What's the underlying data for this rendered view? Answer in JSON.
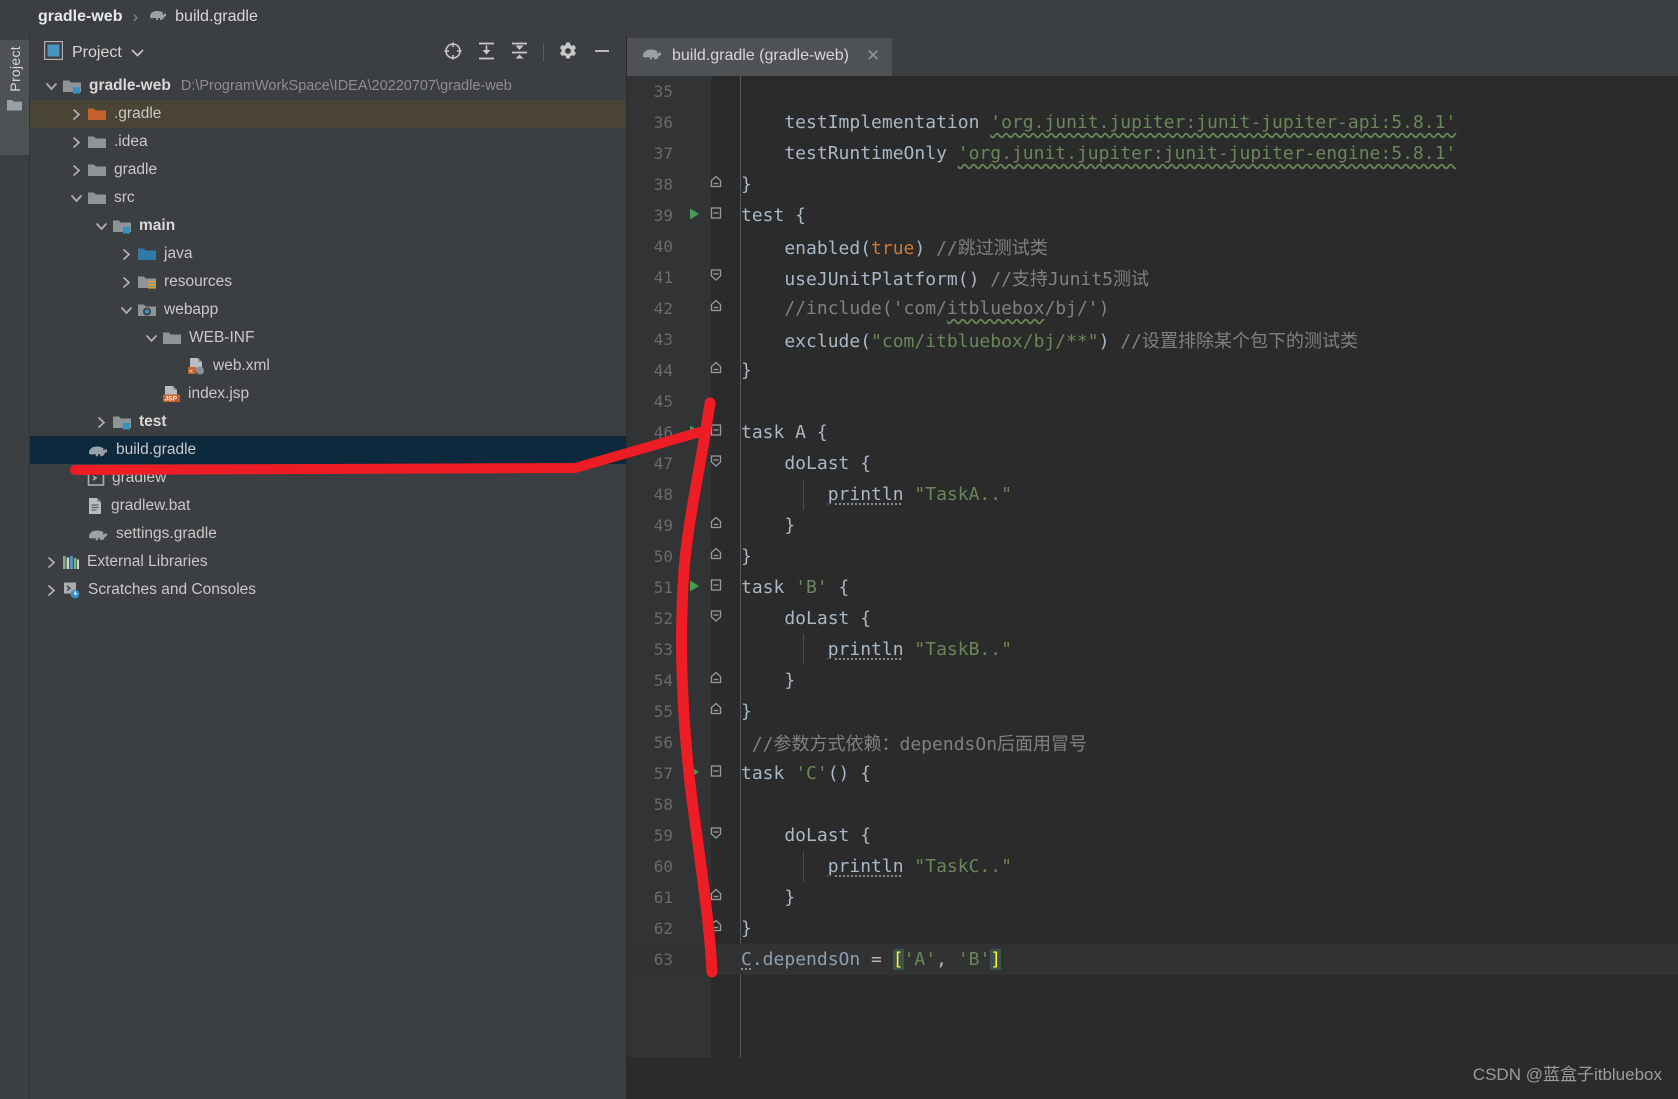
{
  "window": {
    "breadcrumb": {
      "project": "gradle-web",
      "separator": "›",
      "file": "build.gradle"
    },
    "watermark": "CSDN @蓝盒子itbluebox"
  },
  "tool_stripe": {
    "project_button_label": "Project",
    "project_button_icon": "folder-icon"
  },
  "project_panel": {
    "title": "Project",
    "title_icon": "project-view-icon",
    "dropdown_icon": "chevron-down-icon",
    "toolbar_icons": [
      "select-opened-file-icon",
      "expand-all-icon",
      "collapse-all-icon",
      "settings-gear-icon",
      "hide-panel-icon"
    ],
    "tree": [
      {
        "label": "gradle-web",
        "path": "D:\\ProgramWorkSpace\\IDEA\\20220707\\gradle-web",
        "icon": "module-folder-icon",
        "arrow": "expanded",
        "depth": 0,
        "bold": true,
        "state": "normal"
      },
      {
        "label": ".gradle",
        "path": "",
        "icon": "excluded-folder-icon",
        "arrow": "collapsed",
        "depth": 1,
        "bold": false,
        "state": "hover"
      },
      {
        "label": ".idea",
        "path": "",
        "icon": "folder-icon",
        "arrow": "collapsed",
        "depth": 1,
        "bold": false,
        "state": "normal"
      },
      {
        "label": "gradle",
        "path": "",
        "icon": "folder-icon",
        "arrow": "collapsed",
        "depth": 1,
        "bold": false,
        "state": "normal"
      },
      {
        "label": "src",
        "path": "",
        "icon": "folder-icon",
        "arrow": "expanded",
        "depth": 1,
        "bold": false,
        "state": "normal"
      },
      {
        "label": "main",
        "path": "",
        "icon": "module-folder-icon",
        "arrow": "expanded",
        "depth": 2,
        "bold": true,
        "state": "normal"
      },
      {
        "label": "java",
        "path": "",
        "icon": "source-root-icon",
        "arrow": "collapsed",
        "depth": 3,
        "bold": false,
        "state": "normal"
      },
      {
        "label": "resources",
        "path": "",
        "icon": "resource-root-icon",
        "arrow": "collapsed",
        "depth": 3,
        "bold": false,
        "state": "normal"
      },
      {
        "label": "webapp",
        "path": "",
        "icon": "web-root-icon",
        "arrow": "expanded",
        "depth": 3,
        "bold": false,
        "state": "normal"
      },
      {
        "label": "WEB-INF",
        "path": "",
        "icon": "folder-icon",
        "arrow": "expanded",
        "depth": 4,
        "bold": false,
        "state": "normal"
      },
      {
        "label": "web.xml",
        "path": "",
        "icon": "xml-file-icon",
        "arrow": "none",
        "depth": 5,
        "bold": false,
        "state": "normal"
      },
      {
        "label": "index.jsp",
        "path": "",
        "icon": "jsp-file-icon",
        "arrow": "none",
        "depth": 4,
        "bold": false,
        "state": "normal"
      },
      {
        "label": "test",
        "path": "",
        "icon": "module-folder-icon",
        "arrow": "collapsed",
        "depth": 2,
        "bold": true,
        "state": "normal"
      },
      {
        "label": "build.gradle",
        "path": "",
        "icon": "gradle-file-icon",
        "arrow": "none",
        "depth": 1,
        "bold": false,
        "state": "selected"
      },
      {
        "label": "gradlew",
        "path": "",
        "icon": "shell-script-icon",
        "arrow": "none",
        "depth": 1,
        "bold": false,
        "state": "normal"
      },
      {
        "label": "gradlew.bat",
        "path": "",
        "icon": "bat-file-icon",
        "arrow": "none",
        "depth": 1,
        "bold": false,
        "state": "normal"
      },
      {
        "label": "settings.gradle",
        "path": "",
        "icon": "gradle-file-icon",
        "arrow": "none",
        "depth": 1,
        "bold": false,
        "state": "normal"
      },
      {
        "label": "External Libraries",
        "path": "",
        "icon": "external-libraries-icon",
        "arrow": "collapsed",
        "depth": 0,
        "bold": false,
        "state": "normal"
      },
      {
        "label": "Scratches and Consoles",
        "path": "",
        "icon": "scratches-icon",
        "arrow": "collapsed",
        "depth": 0,
        "bold": false,
        "state": "normal"
      }
    ]
  },
  "editor": {
    "tabs": [
      {
        "label": "build.gradle (gradle-web)",
        "icon": "gradle-file-icon",
        "close_icon": "close-icon",
        "active": true
      }
    ],
    "first_line_number": 35,
    "lines": [
      {
        "n": 35,
        "run": false,
        "fold": "none",
        "caret": false,
        "tokens": []
      },
      {
        "n": 36,
        "run": false,
        "fold": "none",
        "caret": false,
        "tokens": [
          {
            "t": "    testImplementation ",
            "c": "s-def"
          },
          {
            "t": "'org.junit.jupiter:junit-jupiter-api:5.8.1'",
            "c": "s-str wavy"
          }
        ]
      },
      {
        "n": 37,
        "run": false,
        "fold": "none",
        "caret": false,
        "tokens": [
          {
            "t": "    testRuntimeOnly ",
            "c": "s-def"
          },
          {
            "t": "'org.junit.jupiter:junit-jupiter-engine:5.8.1'",
            "c": "s-str wavy"
          }
        ]
      },
      {
        "n": 38,
        "run": false,
        "fold": "end",
        "caret": false,
        "tokens": [
          {
            "t": "}",
            "c": "s-def"
          }
        ]
      },
      {
        "n": 39,
        "run": true,
        "fold": "start",
        "caret": false,
        "tokens": [
          {
            "t": "test {",
            "c": "s-def"
          }
        ]
      },
      {
        "n": 40,
        "run": false,
        "fold": "none",
        "caret": false,
        "tokens": [
          {
            "t": "    enabled(",
            "c": "s-def"
          },
          {
            "t": "true",
            "c": "s-kw"
          },
          {
            "t": ") ",
            "c": "s-def"
          },
          {
            "t": "//跳过测试类",
            "c": "s-cmt"
          }
        ]
      },
      {
        "n": 41,
        "run": false,
        "fold": "mid",
        "caret": false,
        "tokens": [
          {
            "t": "    useJUnitPlatform() ",
            "c": "s-def"
          },
          {
            "t": "//支持Junit5测试",
            "c": "s-cmt"
          }
        ]
      },
      {
        "n": 42,
        "run": false,
        "fold": "end",
        "caret": false,
        "tokens": [
          {
            "t": "    //include('com/",
            "c": "s-cmt"
          },
          {
            "t": "itbluebox",
            "c": "s-cmt wavy"
          },
          {
            "t": "/bj/')",
            "c": "s-cmt"
          }
        ]
      },
      {
        "n": 43,
        "run": false,
        "fold": "none",
        "caret": false,
        "tokens": [
          {
            "t": "    exclude(",
            "c": "s-def"
          },
          {
            "t": "\"com/itbluebox/bj/**\"",
            "c": "s-str"
          },
          {
            "t": ") ",
            "c": "s-def"
          },
          {
            "t": "//设置排除某个包下的测试类",
            "c": "s-cmt"
          }
        ]
      },
      {
        "n": 44,
        "run": false,
        "fold": "end",
        "caret": false,
        "tokens": [
          {
            "t": "}",
            "c": "s-def"
          }
        ]
      },
      {
        "n": 45,
        "run": false,
        "fold": "none",
        "caret": false,
        "tokens": []
      },
      {
        "n": 46,
        "run": true,
        "fold": "start",
        "caret": false,
        "tokens": [
          {
            "t": "task A {",
            "c": "s-def"
          }
        ]
      },
      {
        "n": 47,
        "run": false,
        "fold": "mid",
        "caret": false,
        "tokens": [
          {
            "t": "    doLast {",
            "c": "s-def"
          }
        ]
      },
      {
        "n": 48,
        "run": false,
        "fold": "none",
        "caret": false,
        "tokens": [
          {
            "t": "        ",
            "c": "s-def"
          },
          {
            "t": "println",
            "c": "s-def dotted"
          },
          {
            "t": " ",
            "c": "s-def"
          },
          {
            "t": "\"TaskA..\"",
            "c": "s-str"
          }
        ]
      },
      {
        "n": 49,
        "run": false,
        "fold": "end",
        "caret": false,
        "tokens": [
          {
            "t": "    }",
            "c": "s-def"
          }
        ]
      },
      {
        "n": 50,
        "run": false,
        "fold": "end",
        "caret": false,
        "tokens": [
          {
            "t": "}",
            "c": "s-def"
          }
        ]
      },
      {
        "n": 51,
        "run": true,
        "fold": "start",
        "caret": false,
        "tokens": [
          {
            "t": "task ",
            "c": "s-def"
          },
          {
            "t": "'B'",
            "c": "s-str"
          },
          {
            "t": " {",
            "c": "s-def"
          }
        ]
      },
      {
        "n": 52,
        "run": false,
        "fold": "mid",
        "caret": false,
        "tokens": [
          {
            "t": "    doLast {",
            "c": "s-def"
          }
        ]
      },
      {
        "n": 53,
        "run": false,
        "fold": "none",
        "caret": false,
        "tokens": [
          {
            "t": "        ",
            "c": "s-def"
          },
          {
            "t": "println",
            "c": "s-def dotted"
          },
          {
            "t": " ",
            "c": "s-def"
          },
          {
            "t": "\"TaskB..\"",
            "c": "s-str"
          }
        ]
      },
      {
        "n": 54,
        "run": false,
        "fold": "end",
        "caret": false,
        "tokens": [
          {
            "t": "    }",
            "c": "s-def"
          }
        ]
      },
      {
        "n": 55,
        "run": false,
        "fold": "end",
        "caret": false,
        "tokens": [
          {
            "t": "}",
            "c": "s-def"
          }
        ]
      },
      {
        "n": 56,
        "run": false,
        "fold": "none",
        "caret": false,
        "tokens": [
          {
            "t": " //参数方式依赖：dependsOn后面用冒号",
            "c": "s-cmt"
          }
        ]
      },
      {
        "n": 57,
        "run": true,
        "fold": "start",
        "caret": false,
        "tokens": [
          {
            "t": "task ",
            "c": "s-def"
          },
          {
            "t": "'C'",
            "c": "s-str"
          },
          {
            "t": "() {",
            "c": "s-def"
          }
        ]
      },
      {
        "n": 58,
        "run": false,
        "fold": "none",
        "caret": false,
        "tokens": []
      },
      {
        "n": 59,
        "run": false,
        "fold": "mid",
        "caret": false,
        "tokens": [
          {
            "t": "    doLast {",
            "c": "s-def"
          }
        ]
      },
      {
        "n": 60,
        "run": false,
        "fold": "none",
        "caret": false,
        "tokens": [
          {
            "t": "        ",
            "c": "s-def"
          },
          {
            "t": "println",
            "c": "s-def dotted"
          },
          {
            "t": " ",
            "c": "s-def"
          },
          {
            "t": "\"TaskC..\"",
            "c": "s-str"
          }
        ]
      },
      {
        "n": 61,
        "run": false,
        "fold": "end",
        "caret": false,
        "tokens": [
          {
            "t": "    }",
            "c": "s-def"
          }
        ]
      },
      {
        "n": 62,
        "run": false,
        "fold": "end",
        "caret": false,
        "tokens": [
          {
            "t": "}",
            "c": "s-def"
          }
        ]
      },
      {
        "n": 63,
        "run": false,
        "fold": "none",
        "caret": true,
        "tokens": [
          {
            "t": "C",
            "c": "s-prop dotted"
          },
          {
            "t": ".dependsOn",
            "c": "s-prop"
          },
          {
            "t": " = ",
            "c": "s-def"
          },
          {
            "t": "[",
            "c": "s-brkhl"
          },
          {
            "t": "'A'",
            "c": "s-str"
          },
          {
            "t": ", ",
            "c": "s-def"
          },
          {
            "t": "'B'",
            "c": "s-str"
          },
          {
            "t": "]",
            "c": "s-brkhl"
          }
        ]
      }
    ]
  },
  "annotation": {
    "color": "#ee1c24",
    "shape": "red-arrow-pointing-from-build-gradle-to-task-block"
  },
  "colors": {
    "editor_background": "#2b2b2b",
    "gutter_background": "#313335",
    "panel_background": "#3c3f41",
    "selection_background": "#0d293e",
    "hover_background": "#4a4436",
    "string_green": "#6a8759",
    "keyword_orange": "#cc7832",
    "comment_gray": "#808080",
    "default_text": "#a9b7c6",
    "annotation_red": "#ee1c24"
  }
}
